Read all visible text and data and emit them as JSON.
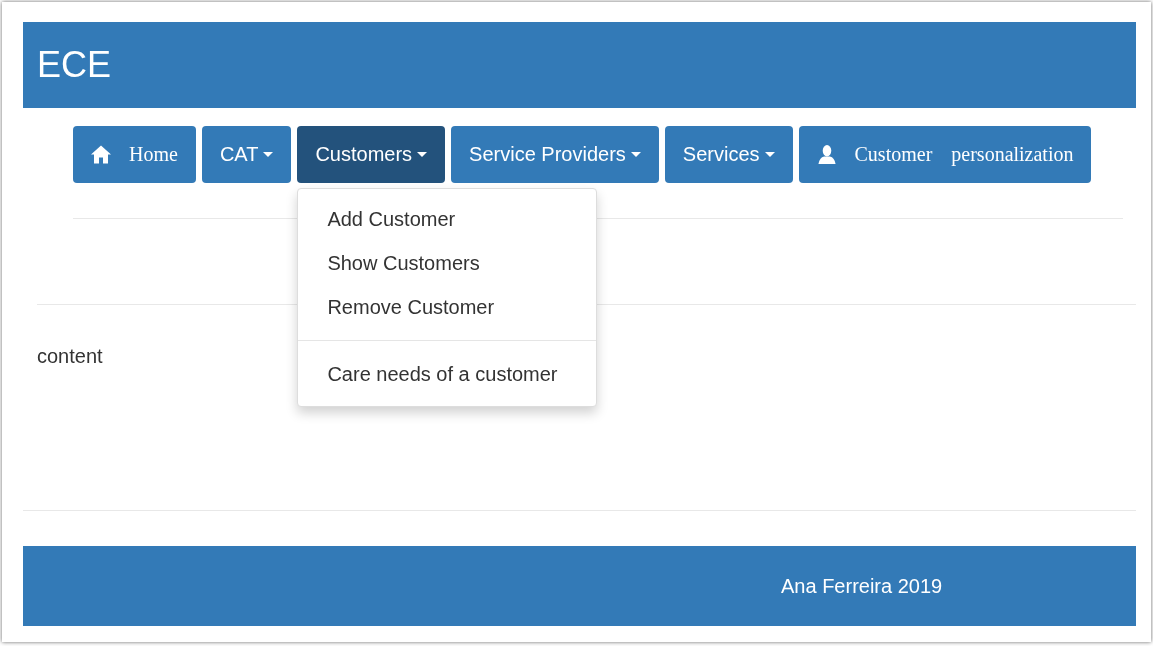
{
  "header": {
    "title": "ECE"
  },
  "nav": [
    {
      "kind": "home",
      "label": "Home",
      "selected": false
    },
    {
      "kind": "dropdown",
      "label": "CAT",
      "selected": false
    },
    {
      "kind": "dropdown",
      "label": "Customers",
      "selected": true,
      "expanded": true,
      "menu": [
        {
          "kind": "item",
          "label": "Add Customer"
        },
        {
          "kind": "item",
          "label": "Show Customers"
        },
        {
          "kind": "item",
          "label": "Remove Customer"
        },
        {
          "kind": "divider"
        },
        {
          "kind": "item",
          "label": "Care needs of a customer"
        }
      ]
    },
    {
      "kind": "dropdown",
      "label": "Service Providers",
      "selected": false
    },
    {
      "kind": "dropdown",
      "label": "Services",
      "selected": false
    },
    {
      "kind": "user",
      "label": "Customer personalization",
      "selected": false
    }
  ],
  "content": "content",
  "footer": "Ana Ferreira 2019"
}
